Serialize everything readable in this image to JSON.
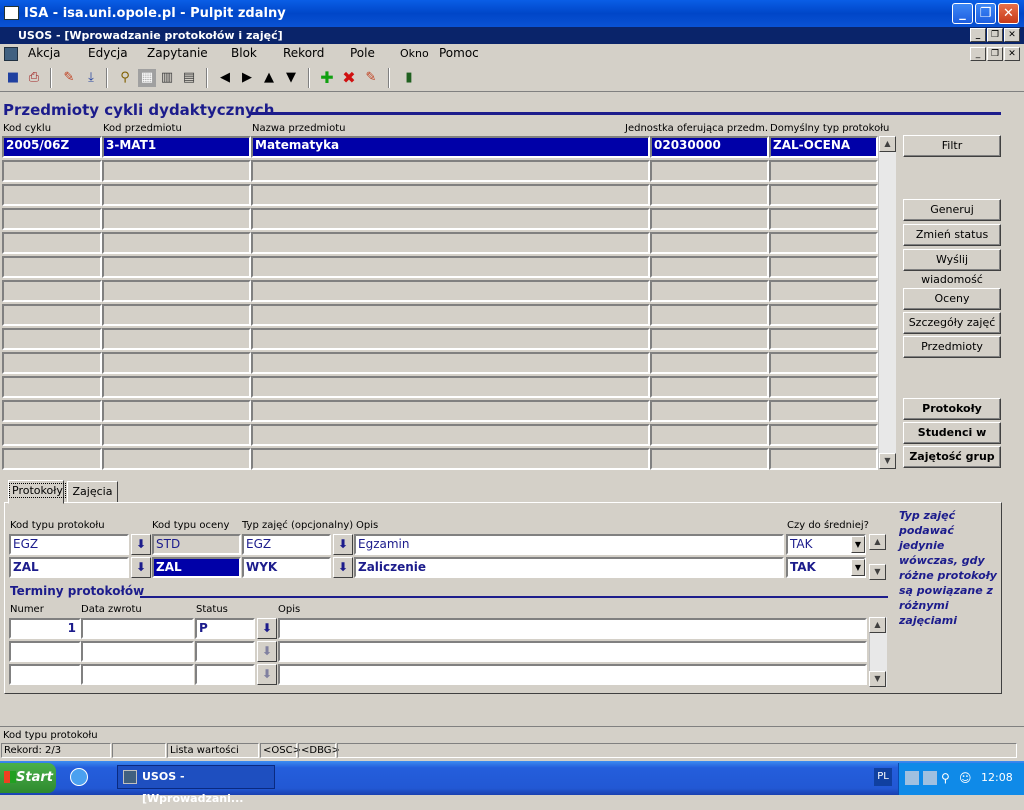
{
  "window": {
    "title": "ISA - isa.uni.opole.pl - Pulpit zdalny",
    "inner_title": "USOS - [Wprowadzanie protokołów i zajęć]"
  },
  "menu": [
    "Akcja",
    "Edycja",
    "Zapytanie",
    "Blok",
    "Rekord",
    "Pole",
    "Okno",
    "Pomoc"
  ],
  "section1": {
    "title": "Przedmioty cykli dydaktycznych",
    "columns": {
      "kod_cyklu": "Kod cyklu",
      "kod_przedmiotu": "Kod przedmiotu",
      "nazwa": "Nazwa przedmiotu",
      "jednostka": "Jednostka oferująca przedm.",
      "typ_protokolu": "Domyślny typ protokołu"
    },
    "row": {
      "kod_cyklu": "2005/06Z",
      "kod_przedmiotu": "3-MAT1",
      "nazwa": "Matematyka",
      "jednostka": "02030000",
      "typ_protokolu": "ZAL-OCENA"
    }
  },
  "buttons": {
    "filtr": "Filtr",
    "generuj": "Generuj protokoły",
    "zmien": "Zmień status prot.",
    "wyslij": "Wyślij wiadomość",
    "oceny": "Oceny",
    "szczegoly": "Szczegóły zajęć",
    "przedmioty": "Przedmioty",
    "protokoly": "Protokoły",
    "studenci": "Studenci w grp.",
    "zajetosc": "Zajętość grup"
  },
  "tabs": {
    "protokoly": "Protokoły",
    "zajecia": "Zajęcia"
  },
  "protokoly": {
    "labels": {
      "kod_typu": "Kod typu protokołu",
      "kod_oceny": "Kod typu oceny",
      "typ_zajec": "Typ zajęć (opcjonalny)",
      "opis": "Opis",
      "czy": "Czy do średniej?"
    },
    "rows": [
      {
        "kod_typu": "EGZ",
        "kod_oceny": "STD",
        "typ_zajec": "EGZ",
        "opis": "Egzamin",
        "czy": "TAK"
      },
      {
        "kod_typu": "ZAL",
        "kod_oceny": "ZAL",
        "typ_zajec": "WYK",
        "opis": "Zaliczenie",
        "czy": "TAK"
      }
    ],
    "note": "Typ zajęć podawać jedynie wówczas, gdy różne protokoły są powiązane z różnymi zajęciami"
  },
  "terminy": {
    "title": "Terminy protokołów",
    "labels": {
      "numer": "Numer",
      "data": "Data zwrotu",
      "status": "Status",
      "opis": "Opis"
    },
    "rows": [
      {
        "numer": "1",
        "data": "",
        "status": "P",
        "opis": ""
      }
    ]
  },
  "statusbar": {
    "hint": "Kod typu protokołu",
    "record": "Rekord: 2/3",
    "lista": "Lista wartości",
    "osc": "<OSC>",
    "dbg": "<DBG>"
  },
  "taskbar": {
    "start": "Start",
    "task": "USOS - [Wprowadzani...",
    "lang": "PL",
    "clock": "12:08"
  }
}
